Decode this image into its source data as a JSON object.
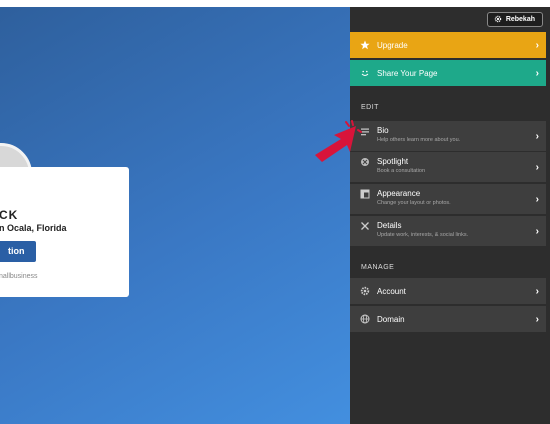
{
  "profile": {
    "name": "CK",
    "location": "n Ocala, Florida",
    "button_label": "tion",
    "tag": "nallbusiness"
  },
  "header": {
    "user_label": "Rebekah"
  },
  "menu": {
    "upgrade": "Upgrade",
    "share": "Share Your Page",
    "edit_section": "EDIT",
    "manage_section": "MANAGE",
    "items": [
      {
        "label": "Bio",
        "sub": "Help others learn more about you.",
        "icon": "bio-icon"
      },
      {
        "label": "Spotlight",
        "sub": "Book a consultation",
        "icon": "spotlight-icon"
      },
      {
        "label": "Appearance",
        "sub": "Change your layout or photos.",
        "icon": "appearance-icon"
      },
      {
        "label": "Details",
        "sub": "Update work, interests, & social links.",
        "icon": "details-icon"
      }
    ],
    "account": "Account",
    "domain": "Domain",
    "chevron": "›"
  },
  "colors": {
    "upgrade": "#e9a514",
    "share": "#1ea98a",
    "panel": "#2d2d2d",
    "row": "#3e3e3e",
    "arrow": "#d8143a"
  }
}
